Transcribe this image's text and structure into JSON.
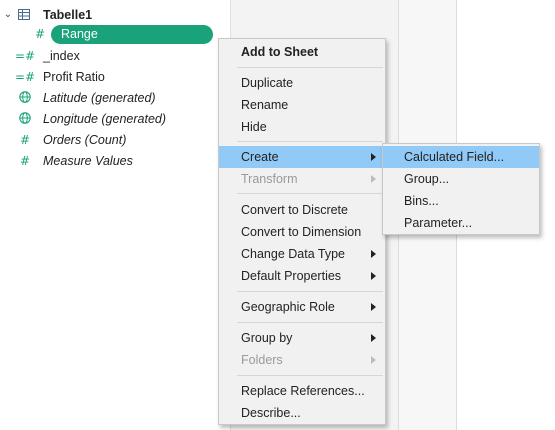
{
  "data_pane": {
    "table_name": "Tabelle1",
    "fields": [
      {
        "name": "Range",
        "icon": "hash-icon",
        "italic": false,
        "selected": true
      },
      {
        "name": "_index",
        "icon": "hash-icon",
        "italic": false
      },
      {
        "name": "Profit Ratio",
        "icon": "hash-icon",
        "italic": false
      },
      {
        "name": "Latitude (generated)",
        "icon": "globe-icon",
        "italic": true
      },
      {
        "name": "Longitude (generated)",
        "icon": "globe-icon",
        "italic": true
      },
      {
        "name": "Orders (Count)",
        "icon": "hash-icon",
        "italic": true
      },
      {
        "name": "Measure Values",
        "icon": "hash-icon",
        "italic": true
      }
    ]
  },
  "context_menu": {
    "items": [
      {
        "label": "Add to Sheet"
      },
      {
        "label": "Duplicate"
      },
      {
        "label": "Rename"
      },
      {
        "label": "Hide"
      },
      {
        "label": "Create"
      },
      {
        "label": "Transform"
      },
      {
        "label": "Convert to Discrete"
      },
      {
        "label": "Convert to Dimension"
      },
      {
        "label": "Change Data Type"
      },
      {
        "label": "Default Properties"
      },
      {
        "label": "Geographic Role"
      },
      {
        "label": "Group by"
      },
      {
        "label": "Folders"
      },
      {
        "label": "Replace References..."
      },
      {
        "label": "Describe..."
      }
    ]
  },
  "submenu": {
    "items": [
      {
        "label": "Calculated Field..."
      },
      {
        "label": "Group..."
      },
      {
        "label": "Bins..."
      },
      {
        "label": "Parameter..."
      }
    ]
  },
  "colors": {
    "measure_green": "#1aa37a",
    "highlight_blue": "#91c9f7",
    "menu_bg": "#f1f1f1"
  }
}
